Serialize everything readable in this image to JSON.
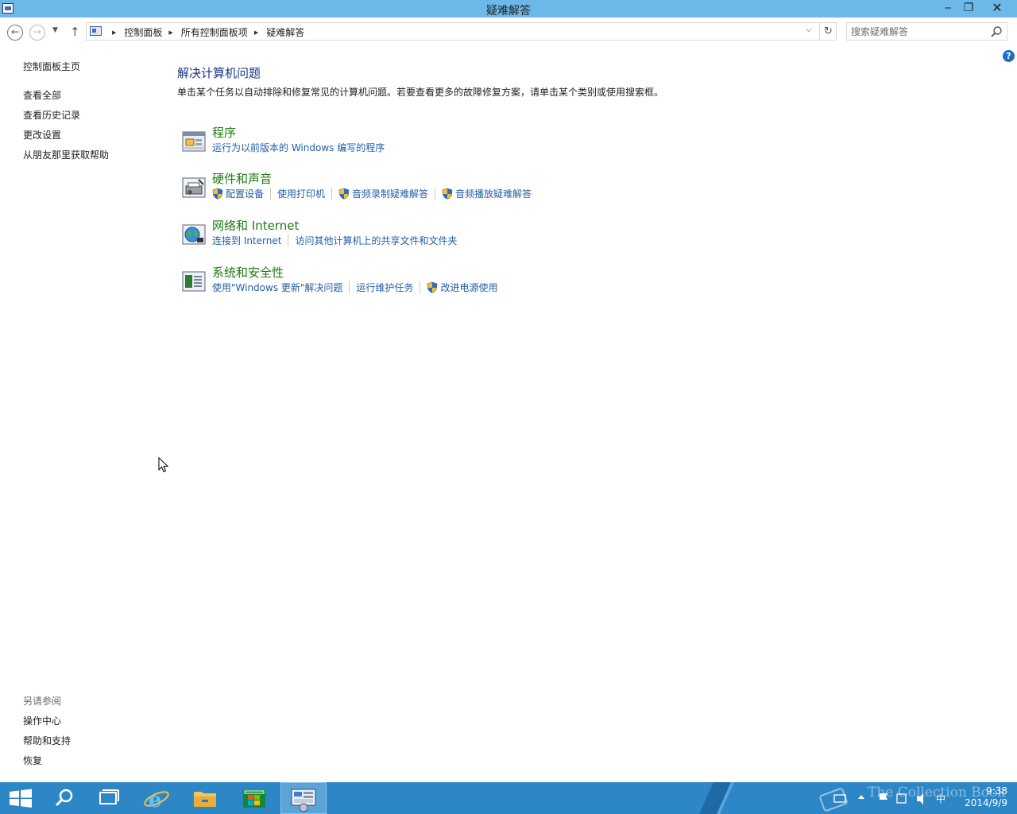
{
  "window": {
    "title": "疑难解答",
    "minimize_glyph": "‒",
    "maximize_glyph": "❐",
    "close_glyph": "✕"
  },
  "address": {
    "crumbs": [
      "控制面板",
      "所有控制面板项",
      "疑难解答"
    ],
    "search_placeholder": "搜索疑难解答"
  },
  "sidebar": {
    "home": "控制面板主页",
    "items": [
      "查看全部",
      "查看历史记录",
      "更改设置",
      "从朋友那里获取帮助"
    ],
    "see_also_label": "另请参阅",
    "see_also": [
      "操作中心",
      "帮助和支持",
      "恢复"
    ]
  },
  "main": {
    "help": "?",
    "title": "解决计算机问题",
    "description": "单击某个任务以自动排除和修复常见的计算机问题。若要查看更多的故障修复方案，请单击某个类别或使用搜索框。",
    "categories": [
      {
        "title": "程序",
        "icon": "programs-icon",
        "links": [
          {
            "label": "运行为以前版本的 Windows 编写的程序",
            "shield": false
          }
        ]
      },
      {
        "title": "硬件和声音",
        "icon": "hardware-sound-icon",
        "links": [
          {
            "label": "配置设备",
            "shield": true
          },
          {
            "label": "使用打印机",
            "shield": false
          },
          {
            "label": "音频录制疑难解答",
            "shield": true
          },
          {
            "label": "音频播放疑难解答",
            "shield": true
          }
        ]
      },
      {
        "title": "网络和 Internet",
        "icon": "network-globe-icon",
        "links": [
          {
            "label": "连接到 Internet",
            "shield": false
          },
          {
            "label": "访问其他计算机上的共享文件和文件夹",
            "shield": false
          }
        ]
      },
      {
        "title": "系统和安全性",
        "icon": "system-security-icon",
        "links": [
          {
            "label": "使用\"Windows 更新\"解决问题",
            "shield": false
          },
          {
            "label": "运行维护任务",
            "shield": false
          },
          {
            "label": "改进电源使用",
            "shield": true
          }
        ]
      }
    ]
  },
  "taskbar": {
    "apps": [
      "start-icon",
      "search-icon",
      "task-view-icon",
      "internet-explorer-icon",
      "file-explorer-icon",
      "store-icon",
      "control-panel-icon"
    ],
    "watermark": "The Collection Book",
    "ime": "中",
    "time": "9:38",
    "date": "2014/9/9"
  },
  "colors": {
    "titlebar": "#6cb8e8",
    "taskbar": "#2d86c6",
    "category_title": "#1d7a12",
    "link": "#1f5fa9",
    "heading": "#1e3287"
  }
}
